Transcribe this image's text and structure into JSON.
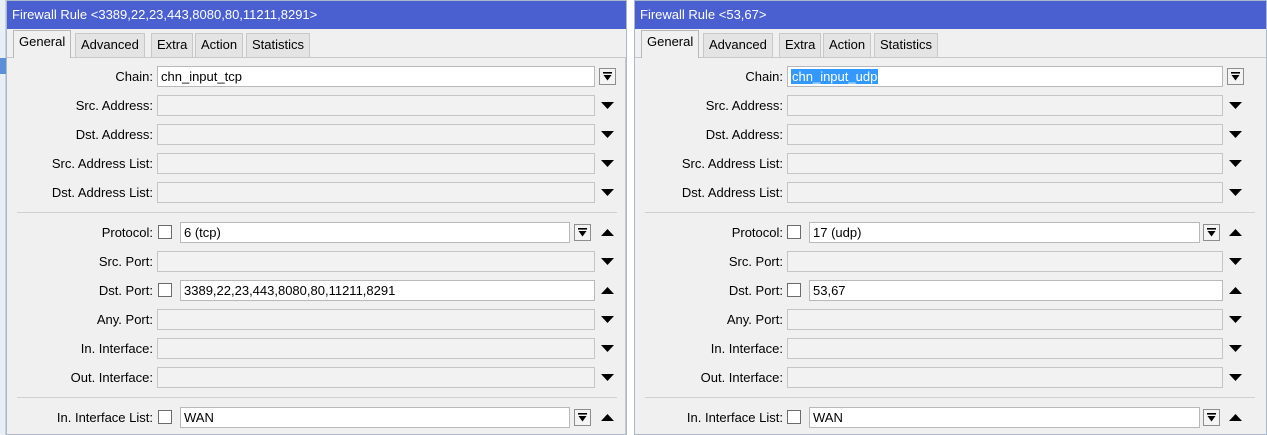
{
  "left_window": {
    "title": "Firewall Rule <3389,22,23,443,8080,80,11211,8291>",
    "tabs": [
      "General",
      "Advanced",
      "Extra",
      "Action",
      "Statistics"
    ],
    "active_tab": "General",
    "labels": {
      "chain": "Chain:",
      "src_address": "Src. Address:",
      "dst_address": "Dst. Address:",
      "src_address_list": "Src. Address List:",
      "dst_address_list": "Dst. Address List:",
      "protocol": "Protocol:",
      "src_port": "Src. Port:",
      "dst_port": "Dst. Port:",
      "any_port": "Any. Port:",
      "in_interface": "In. Interface:",
      "out_interface": "Out. Interface:",
      "in_interface_list": "In. Interface List:"
    },
    "values": {
      "chain": "chn_input_tcp",
      "protocol": "6 (tcp)",
      "dst_port": "3389,22,23,443,8080,80,11211,8291",
      "in_interface_list": "WAN"
    }
  },
  "right_window": {
    "title": "Firewall Rule <53,67>",
    "tabs": [
      "General",
      "Advanced",
      "Extra",
      "Action",
      "Statistics"
    ],
    "active_tab": "General",
    "labels": {
      "chain": "Chain:",
      "src_address": "Src. Address:",
      "dst_address": "Dst. Address:",
      "src_address_list": "Src. Address List:",
      "dst_address_list": "Dst. Address List:",
      "protocol": "Protocol:",
      "src_port": "Src. Port:",
      "dst_port": "Dst. Port:",
      "any_port": "Any. Port:",
      "in_interface": "In. Interface:",
      "out_interface": "Out. Interface:",
      "in_interface_list": "In. Interface List:"
    },
    "values": {
      "chain": "chn_input_udp",
      "protocol": "17 (udp)",
      "dst_port": "53,67",
      "in_interface_list": "WAN"
    }
  },
  "colors": {
    "titlebar": "#4a5fd0",
    "selection": "#3399ff",
    "panel": "#f0f0f0"
  }
}
